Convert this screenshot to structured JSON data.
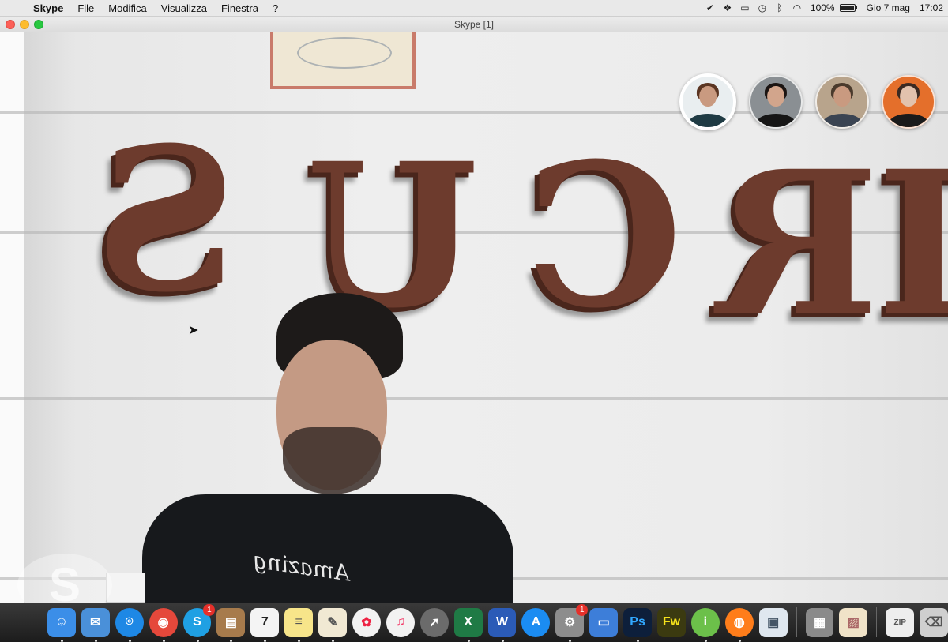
{
  "menubar": {
    "app_name": "Skype",
    "menus": [
      "File",
      "Modifica",
      "Visualizza",
      "Finestra",
      "?"
    ],
    "battery_percent": "100%",
    "battery_level": 1.0,
    "date": "Gio 7 mag",
    "time": "17:02",
    "status_icons": [
      "checkmark-icon",
      "dropbox-icon",
      "airplay-icon",
      "time-machine-icon",
      "bluetooth-icon",
      "wifi-icon"
    ]
  },
  "window": {
    "title": "Skype [1]"
  },
  "video": {
    "sign_letters": [
      "S",
      "U",
      "C",
      "R",
      "I"
    ],
    "shirt_text": "Amazing"
  },
  "participants": [
    {
      "name": "participant-1",
      "active": true,
      "bg": "#e9eef0",
      "skin": "#c99a80",
      "hair": "#5a3522",
      "shirt": "#1f3b44"
    },
    {
      "name": "participant-2",
      "active": false,
      "bg": "#8a8f93",
      "skin": "#d2a58c",
      "hair": "#1b1412",
      "shirt": "#161616"
    },
    {
      "name": "participant-3",
      "active": false,
      "bg": "#b8a48c",
      "skin": "#c99a80",
      "hair": "#4a3a2c",
      "shirt": "#3b4452"
    },
    {
      "name": "participant-4",
      "active": false,
      "bg": "#e46f2b",
      "skin": "#e2c2ad",
      "hair": "#3b2a22",
      "shirt": "#1a1a1a"
    }
  ],
  "dock": {
    "items": [
      {
        "name": "finder-icon",
        "glyph": "☺",
        "bg": "#3b8ee8",
        "running": true
      },
      {
        "name": "mail-icon",
        "glyph": "✉",
        "bg": "#4a90d9",
        "running": true
      },
      {
        "name": "safari-icon",
        "glyph": "⌾",
        "bg": "#1e88e5",
        "running": true,
        "round": true
      },
      {
        "name": "chrome-icon",
        "glyph": "◉",
        "bg": "#e5483b",
        "running": true,
        "round": true
      },
      {
        "name": "skype-icon",
        "glyph": "S",
        "bg": "#1fa0e3",
        "running": true,
        "round": true,
        "badge": "1"
      },
      {
        "name": "notes-book-icon",
        "glyph": "▤",
        "bg": "#a77b4c",
        "running": true
      },
      {
        "name": "calendar-icon",
        "glyph": "7",
        "bg": "#f4f4f4",
        "fg": "#222",
        "running": true
      },
      {
        "name": "notes-icon",
        "glyph": "≡",
        "bg": "#f7e58a",
        "fg": "#555",
        "running": true
      },
      {
        "name": "textedit-icon",
        "glyph": "✎",
        "bg": "#f1e9d3",
        "fg": "#555",
        "running": true
      },
      {
        "name": "photos-icon",
        "glyph": "✿",
        "bg": "#f2f2f2",
        "fg": "#e24",
        "running": false,
        "round": true
      },
      {
        "name": "music-icon",
        "glyph": "♫",
        "bg": "#f2f2f2",
        "fg": "#f23c6a",
        "running": false,
        "round": true
      },
      {
        "name": "launchpad-icon",
        "glyph": "➚",
        "bg": "#6b6b6b",
        "running": false,
        "round": true
      },
      {
        "name": "excel-icon",
        "glyph": "X",
        "bg": "#1f7a45",
        "running": true
      },
      {
        "name": "word-icon",
        "glyph": "W",
        "bg": "#2b5bb7",
        "running": true
      },
      {
        "name": "app-store-icon",
        "glyph": "A",
        "bg": "#1b8cf2",
        "running": false,
        "round": true
      },
      {
        "name": "system-preferences-icon",
        "glyph": "⚙",
        "bg": "#8d8d8d",
        "running": true,
        "badge": "1"
      },
      {
        "name": "keynote-icon",
        "glyph": "▭",
        "bg": "#3d7ed9",
        "running": false
      },
      {
        "name": "photoshop-icon",
        "glyph": "Ps",
        "bg": "#0d1f3b",
        "fg": "#31a8ff",
        "running": true
      },
      {
        "name": "fireworks-icon",
        "glyph": "Fw",
        "bg": "#3b3a10",
        "fg": "#f6e21b",
        "running": false
      },
      {
        "name": "istat-icon",
        "glyph": "i",
        "bg": "#6cc04a",
        "running": true,
        "round": true
      },
      {
        "name": "firefox-icon",
        "glyph": "◍",
        "bg": "#ff7d1a",
        "running": true,
        "round": true
      },
      {
        "name": "preview-icon",
        "glyph": "▣",
        "bg": "#dfe7ef",
        "fg": "#456",
        "running": false
      },
      {
        "separator": true
      },
      {
        "name": "calculator-icon",
        "glyph": "▦",
        "bg": "#8a8a8a",
        "running": false
      },
      {
        "name": "image-stack-icon",
        "glyph": "▨",
        "bg": "#f0e3c8",
        "fg": "#a66",
        "running": false
      },
      {
        "separator": true
      },
      {
        "name": "zip-file-icon",
        "glyph": "ZIP",
        "bg": "#eeeeee",
        "fg": "#555",
        "running": false
      },
      {
        "name": "trash-icon",
        "glyph": "⌫",
        "bg": "#cfcfcf",
        "fg": "#555",
        "running": false
      }
    ]
  }
}
